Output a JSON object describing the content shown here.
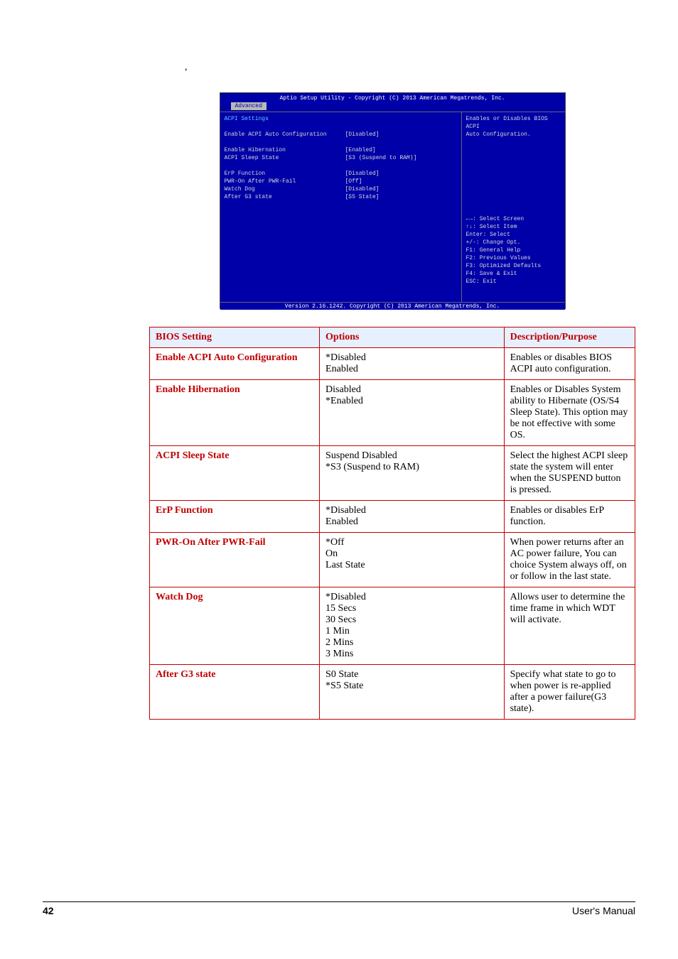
{
  "stray": ",",
  "bios": {
    "header": "Aptio Setup Utility - Copyright (C) 2013 American Megatrends, Inc.",
    "tab": "Advanced",
    "section_title": "ACPI Settings",
    "items": [
      {
        "label": "Enable ACPI Auto Configuration",
        "value": "[Disabled]",
        "hl": true
      },
      {
        "label": "",
        "value": ""
      },
      {
        "label": "Enable Hibernation",
        "value": "[Enabled]"
      },
      {
        "label": "ACPI Sleep State",
        "value": "[S3 (Suspend to RAM)]"
      },
      {
        "label": "",
        "value": ""
      },
      {
        "label": "ErP Function",
        "value": "[Disabled]"
      },
      {
        "label": "PWR-On After PWR-Fail",
        "value": "[Off]"
      },
      {
        "label": "Watch Dog",
        "value": "[Disabled]"
      },
      {
        "label": "After G3 state",
        "value": "[S5 State]"
      }
    ],
    "help_text_1": "Enables or Disables BIOS ACPI",
    "help_text_2": "Auto Configuration.",
    "keys": [
      "←→: Select Screen",
      "↑↓: Select Item",
      "Enter: Select",
      "+/-: Change Opt.",
      "F1: General Help",
      "F2: Previous Values",
      "F3: Optimized Defaults",
      "F4: Save & Exit",
      "ESC: Exit"
    ],
    "footer": "Version 2.16.1242. Copyright (C) 2013 American Megatrends, Inc."
  },
  "table": {
    "headers": [
      "BIOS Setting",
      "Options",
      "Description/Purpose"
    ],
    "rows": [
      {
        "setting": "Enable ACPI Auto Configuration",
        "options": "*Disabled\nEnabled",
        "desc": "Enables or disables BIOS ACPI auto configuration."
      },
      {
        "setting": "Enable Hibernation",
        "options": "Disabled\n*Enabled",
        "desc": "Enables or Disables System ability to Hibernate (OS/S4 Sleep State). This option may be not effective with some OS."
      },
      {
        "setting": "ACPI Sleep State",
        "options": "Suspend Disabled\n*S3 (Suspend to RAM)",
        "desc": "Select the highest ACPI sleep state the system will enter when the SUSPEND button is pressed."
      },
      {
        "setting": "ErP Function",
        "options": "*Disabled\nEnabled",
        "desc": "Enables or disables ErP function."
      },
      {
        "setting": "PWR-On After PWR-Fail",
        "options": "*Off\nOn\nLast State",
        "desc": "When power returns after an AC power failure, You can choice System always off, on or follow in the last state."
      },
      {
        "setting": "Watch Dog",
        "options": "*Disabled\n15 Secs\n30 Secs\n1 Min\n2 Mins\n3 Mins",
        "desc": "Allows user to determine the time frame in which WDT will activate."
      },
      {
        "setting": "After G3 state",
        "options": "S0 State\n*S5 State",
        "desc": "Specify what state to go to when power is re-applied after a power failure(G3 state)."
      }
    ]
  },
  "footer": {
    "page": "42",
    "manual": "User's Manual"
  }
}
